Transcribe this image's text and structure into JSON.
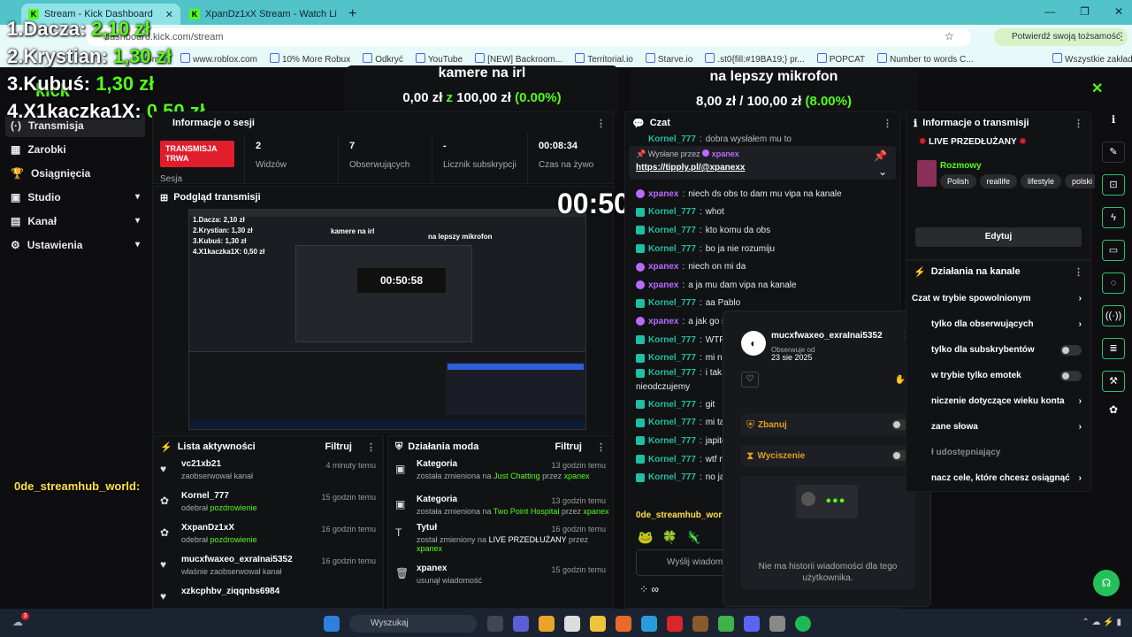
{
  "browser": {
    "tabs": [
      {
        "title": "Stream - Kick Dashboard",
        "active": true
      },
      {
        "title": "XpanDz1xX Stream - Watch Li",
        "active": false
      }
    ],
    "url": "dashboard.kick.com/stream",
    "verify_label": "Potwierdź swoją tożsamość",
    "bookmarks": [
      "Gmail",
      "www.roblox.com",
      "10% More Robux",
      "Odkryć",
      "YouTube",
      "[NEW] Backroom...",
      "Territorial.io",
      "Starve.io",
      ".st0{fill:#19BA19;} pr...",
      "POPCAT",
      "Number to words C..."
    ],
    "all_bookmarks": "Wszystkie zakładki"
  },
  "overlay": {
    "leaderboard": [
      {
        "rank": "1.",
        "name": "Dacza:",
        "value": "2,10 zł"
      },
      {
        "rank": "2.",
        "name": "Krystian:",
        "value": "1,30 zł"
      },
      {
        "rank": "3.",
        "name": "Kubuś:",
        "value": "1,30 zł"
      },
      {
        "rank": "4.",
        "name": "X1kaczka1X:",
        "value": "0,50 zł"
      }
    ],
    "goal1": {
      "title": "kamere na irl",
      "current": "0,00 zł",
      "sep": "z",
      "target": "100,00 zł",
      "pct": "(0.00%)"
    },
    "goal2": {
      "title": "na lepszy mikrofon",
      "current": "8,00 zł",
      "sep": "/",
      "target": "100,00 zł",
      "pct": "(8.00%)"
    },
    "timer": "00:50:44",
    "streamhub": "0de_streamhub_world:",
    "close_symbol": "✕"
  },
  "sidebar": {
    "logo": "kick",
    "items": [
      {
        "label": "Transmisja",
        "active": true
      },
      {
        "label": "Zarobki"
      },
      {
        "label": "Osiągnięcia"
      },
      {
        "label": "Studio",
        "chevron": true
      },
      {
        "label": "Kanał",
        "chevron": true
      },
      {
        "label": "Ustawienia",
        "chevron": true
      }
    ]
  },
  "session": {
    "title": "Informacje o sesji",
    "badge": "TRANSMISJA TRWA",
    "badge_sub": "Sesja",
    "stats": [
      {
        "value": "2",
        "label": "Widzów"
      },
      {
        "value": "7",
        "label": "Obserwujących"
      },
      {
        "value": "-",
        "label": "Licznik subskrypcji"
      },
      {
        "value": "00:08:34",
        "label": "Czas na żywo"
      }
    ]
  },
  "preview": {
    "title": "Podgląd transmisji",
    "inner_timer": "00:50:58",
    "inner_leaderboard": [
      "1.Dacza: 2,10 zł",
      "2.Krystian: 1,30 zł",
      "3.Kubuś: 1,30 zł",
      "4.X1kaczka1X: 0,50 zł"
    ],
    "inner_goal1": "kamere na irl",
    "inner_goal2": "na lepszy mikrofon"
  },
  "activity": {
    "title": "Lista aktywności",
    "filter": "Filtruj",
    "rows": [
      {
        "name": "vc21xb21",
        "sub": "zaobserwował kanał",
        "time": "4 minuty temu"
      },
      {
        "name": "Kornel_777",
        "sub": "odebrał",
        "sub_hl": "pozdrowienie",
        "time": "15 godzin temu"
      },
      {
        "name": "XxpanDz1xX",
        "sub": "odebrał",
        "sub_hl": "pozdrowienie",
        "time": "16 godzin temu"
      },
      {
        "name": "mucxfwaxeo_exraInai5352",
        "sub": "właśnie zaobserwował kanał",
        "time": "16 godzin temu"
      },
      {
        "name": "xzkcphbv_ziqqnbs6984",
        "sub": "",
        "time": ""
      }
    ]
  },
  "modactions": {
    "title": "Działania moda",
    "filter": "Filtruj",
    "rows": [
      {
        "name": "Kategoria",
        "sub": "została zmieniona na",
        "hl": "Just Chatting",
        "by": "przez",
        "user": "xpanex",
        "time": "13 godzin temu"
      },
      {
        "name": "Kategoria",
        "sub": "została zmieniona na",
        "hl": "Two Point Hospital",
        "by": "przez",
        "user": "xpanex",
        "time": "13 godzin temu"
      },
      {
        "name": "Tytuł",
        "sub": "został zmieniony na",
        "hl": "LIVE PRZEDŁUŻANY",
        "by": "przez",
        "user": "xpanex",
        "time": "16 godzin temu"
      },
      {
        "name": "xpanex",
        "sub": "usunął wiadomość",
        "hl": "",
        "by": "",
        "user": "",
        "time": "15 godzin temu"
      }
    ]
  },
  "chat": {
    "title": "Czat",
    "pinned_label": "Wysłane przez",
    "pinned_user": "xpanex",
    "pinned_link": "https://tipply.pl/@xpanexx",
    "messages": [
      {
        "user": "xpanex",
        "text": "niech ds obs to dam mu vipa na kanale",
        "purple": true
      },
      {
        "user": "Kornel_777",
        "text": "whot"
      },
      {
        "user": "Kornel_777",
        "text": "kto komu da obs"
      },
      {
        "user": "Kornel_777",
        "text": "bo ja nie rozumiju"
      },
      {
        "user": "xpanex",
        "text": "niech on mi da",
        "purple": true
      },
      {
        "user": "xpanex",
        "text": "a ja mu dam vipa na kanale",
        "purple": true
      },
      {
        "user": "Kornel_777",
        "text": "aa Pablo"
      },
      {
        "user": "xpanex",
        "text": "a jak go sta",
        "purple": true
      },
      {
        "user": "Kornel_777",
        "text": "WTF M"
      },
      {
        "user": "Kornel_777",
        "text": "mi nie p"
      },
      {
        "user": "Kornel_777",
        "text": "i tak jes"
      },
      {
        "user": "",
        "text": "nieodczujemy"
      },
      {
        "user": "Kornel_777",
        "text": "git"
      },
      {
        "user": "Kornel_777",
        "text": "mi tam"
      },
      {
        "user": "Kornel_777",
        "text": "japitole"
      },
      {
        "user": "Kornel_777",
        "text": "wtf met"
      },
      {
        "user": "Kornel_777",
        "text": "no japie"
      }
    ],
    "top_fragment_user": "Kornel_777",
    "top_fragment_text": "dobra wysłałem mu to",
    "input_placeholder": "Wyślij wiadom",
    "streamhub_line": "0de_streamhub_world:"
  },
  "popup": {
    "username": "mucxfwaxeo_exraInai5352",
    "follow_label": "Obserwuje od",
    "follow_date": "23 sie 2025",
    "ban_label": "Zbanuj",
    "timeout_label": "Wyciszenie",
    "empty_text": "Nie ma historii wiadomości dla tego użytkownika."
  },
  "stream_info": {
    "title": "Informacje o transmisji",
    "stream_title": "LIVE PRZEDŁUŻANY",
    "category": "Rozmowy",
    "tags": [
      "Polish",
      "reallife",
      "lifestyle",
      "polski"
    ],
    "edit": "Edytuj"
  },
  "channel_actions": {
    "title": "Działania na kanale",
    "items": [
      {
        "label": "Czat w trybie spowolnionym",
        "kind": "chevron"
      },
      {
        "label": "tylko dla obserwujących",
        "kind": "chevron"
      },
      {
        "label": "tylko dla subskrybentów",
        "kind": "toggle"
      },
      {
        "label": "w trybie tylko emotek",
        "kind": "toggle"
      },
      {
        "label": "niczenie dotyczące wieku konta",
        "kind": "chevron"
      },
      {
        "label": "zane słowa",
        "kind": "chevron"
      },
      {
        "label": "ł udostępniający",
        "kind": "none"
      },
      {
        "label": "nacz cele, które chcesz osiągnąć",
        "kind": "chevron"
      }
    ]
  },
  "taskbar": {
    "search_placeholder": "Wyszukaj",
    "notif_badge": "3"
  },
  "colors": {
    "accent": "#53fc18",
    "live": "#e11d2c",
    "tab_bar": "#52c3c9"
  }
}
